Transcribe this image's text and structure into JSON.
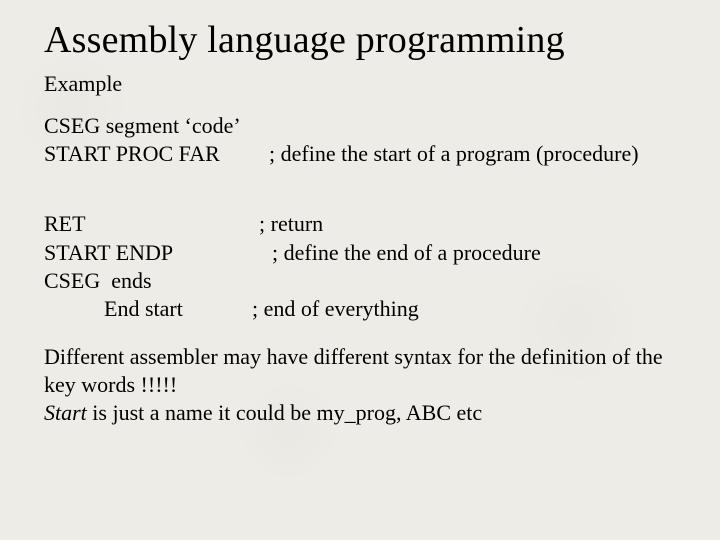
{
  "title": "Assembly language programming",
  "subheading": "Example",
  "code": {
    "l1": "CSEG segment ‘code’",
    "l2a": "START PROC FAR",
    "l2b": "; define the start of a program (procedure)",
    "l3a": "RET",
    "l3b": "; return",
    "l4a": "START ENDP",
    "l4b": "; define the end of a procedure",
    "l5": "CSEG  ends",
    "l6a": "End start",
    "l6b": "; end of everything"
  },
  "note1": "Different assembler may have different syntax for the definition of the key words !!!!!",
  "note2_pre": "Start",
  "note2_post": " is just a name it could be my_prog, ABC etc"
}
